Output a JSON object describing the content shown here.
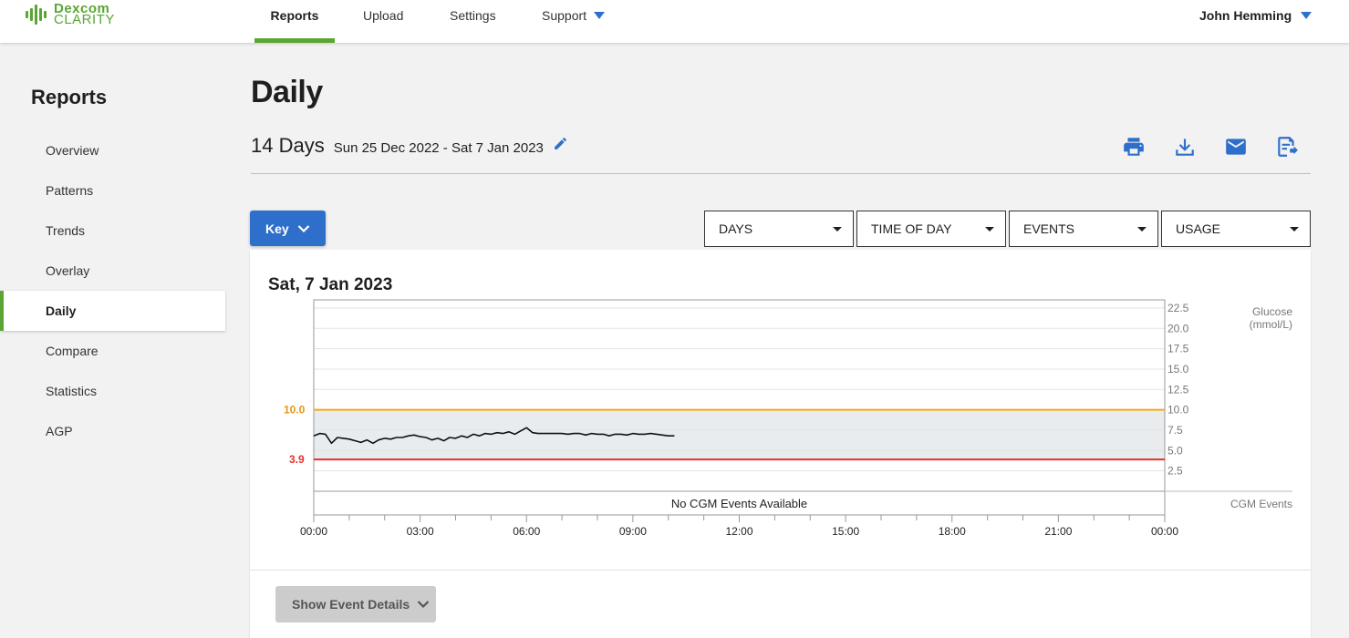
{
  "brand": {
    "line1": "Dexcom",
    "line2": "CLARITY"
  },
  "nav": {
    "items": [
      {
        "label": "Reports",
        "active": true
      },
      {
        "label": "Upload",
        "active": false
      },
      {
        "label": "Settings",
        "active": false
      },
      {
        "label": "Support",
        "active": false,
        "has_menu": true
      }
    ],
    "user": "John Hemming"
  },
  "sidebar": {
    "title": "Reports",
    "items": [
      {
        "label": "Overview"
      },
      {
        "label": "Patterns"
      },
      {
        "label": "Trends"
      },
      {
        "label": "Overlay"
      },
      {
        "label": "Daily",
        "active": true
      },
      {
        "label": "Compare"
      },
      {
        "label": "Statistics"
      },
      {
        "label": "AGP"
      }
    ]
  },
  "page": {
    "title": "Daily",
    "range_days": "14 Days",
    "range_dates": "Sun 25 Dec 2022 - Sat 7 Jan 2023",
    "actions": [
      "print-icon",
      "download-icon",
      "email-icon",
      "export-icon"
    ]
  },
  "controls": {
    "key_label": "Key",
    "dropdowns": [
      "DAYS",
      "TIME OF DAY",
      "EVENTS",
      "USAGE"
    ]
  },
  "card": {
    "date": "Sat, 7 Jan 2023",
    "show_events_label": "Show Event Details"
  },
  "colors": {
    "brand_green": "#59a633",
    "accent_blue": "#2f6fcc",
    "high_line": "#f5a623",
    "low_line": "#e8302a",
    "target_band": "#e9ecef"
  },
  "chart_data": {
    "type": "line",
    "y_unit_label": "Glucose\n(mmol/L)",
    "ylim": [
      0,
      23.5
    ],
    "y_ticks": [
      "2.5",
      "5.0",
      "7.5",
      "10.0",
      "12.5",
      "15.0",
      "17.5",
      "20.0",
      "22.5"
    ],
    "x_ticks": [
      "00:00",
      "03:00",
      "06:00",
      "09:00",
      "12:00",
      "15:00",
      "18:00",
      "21:00",
      "00:00"
    ],
    "high_threshold": "10.0",
    "low_threshold": "3.9",
    "target_range": [
      3.9,
      10.0
    ],
    "events_label": "CGM Events",
    "no_events_text": "No CGM Events Available",
    "series": [
      {
        "x_hours": [
          0.0,
          0.17,
          0.33,
          0.5,
          0.67,
          0.83,
          1.0,
          1.17,
          1.33,
          1.5,
          1.67,
          1.83,
          2.0,
          2.17,
          2.33,
          2.5,
          2.67,
          2.83,
          3.0,
          3.17,
          3.33,
          3.5,
          3.67,
          3.83,
          4.0,
          4.17,
          4.33,
          4.5,
          4.67,
          4.83,
          5.0,
          5.17,
          5.33,
          5.5,
          5.67,
          5.83,
          6.0,
          6.17,
          6.33,
          6.5,
          6.67,
          6.83,
          7.0,
          7.17,
          7.33,
          7.5,
          7.67,
          7.83,
          8.0,
          8.17,
          8.33,
          8.5,
          8.67,
          8.83,
          9.0,
          9.17,
          9.33,
          9.5,
          9.67,
          9.83,
          10.0,
          10.17
        ],
        "values": [
          6.8,
          7.1,
          7.0,
          5.9,
          6.6,
          6.5,
          6.4,
          6.2,
          6.0,
          6.3,
          5.9,
          6.3,
          6.5,
          6.4,
          6.6,
          6.6,
          6.8,
          6.9,
          6.7,
          6.6,
          6.3,
          6.5,
          6.2,
          6.6,
          6.5,
          6.8,
          6.6,
          7.0,
          6.8,
          7.1,
          7.0,
          7.2,
          7.1,
          7.3,
          7.0,
          7.4,
          7.8,
          7.2,
          7.1,
          7.1,
          7.1,
          7.1,
          7.1,
          7.0,
          7.1,
          7.1,
          6.9,
          7.1,
          7.0,
          7.0,
          6.8,
          7.0,
          7.0,
          6.9,
          7.1,
          7.0,
          7.0,
          7.1,
          7.0,
          6.9,
          6.8,
          6.8
        ]
      }
    ]
  }
}
